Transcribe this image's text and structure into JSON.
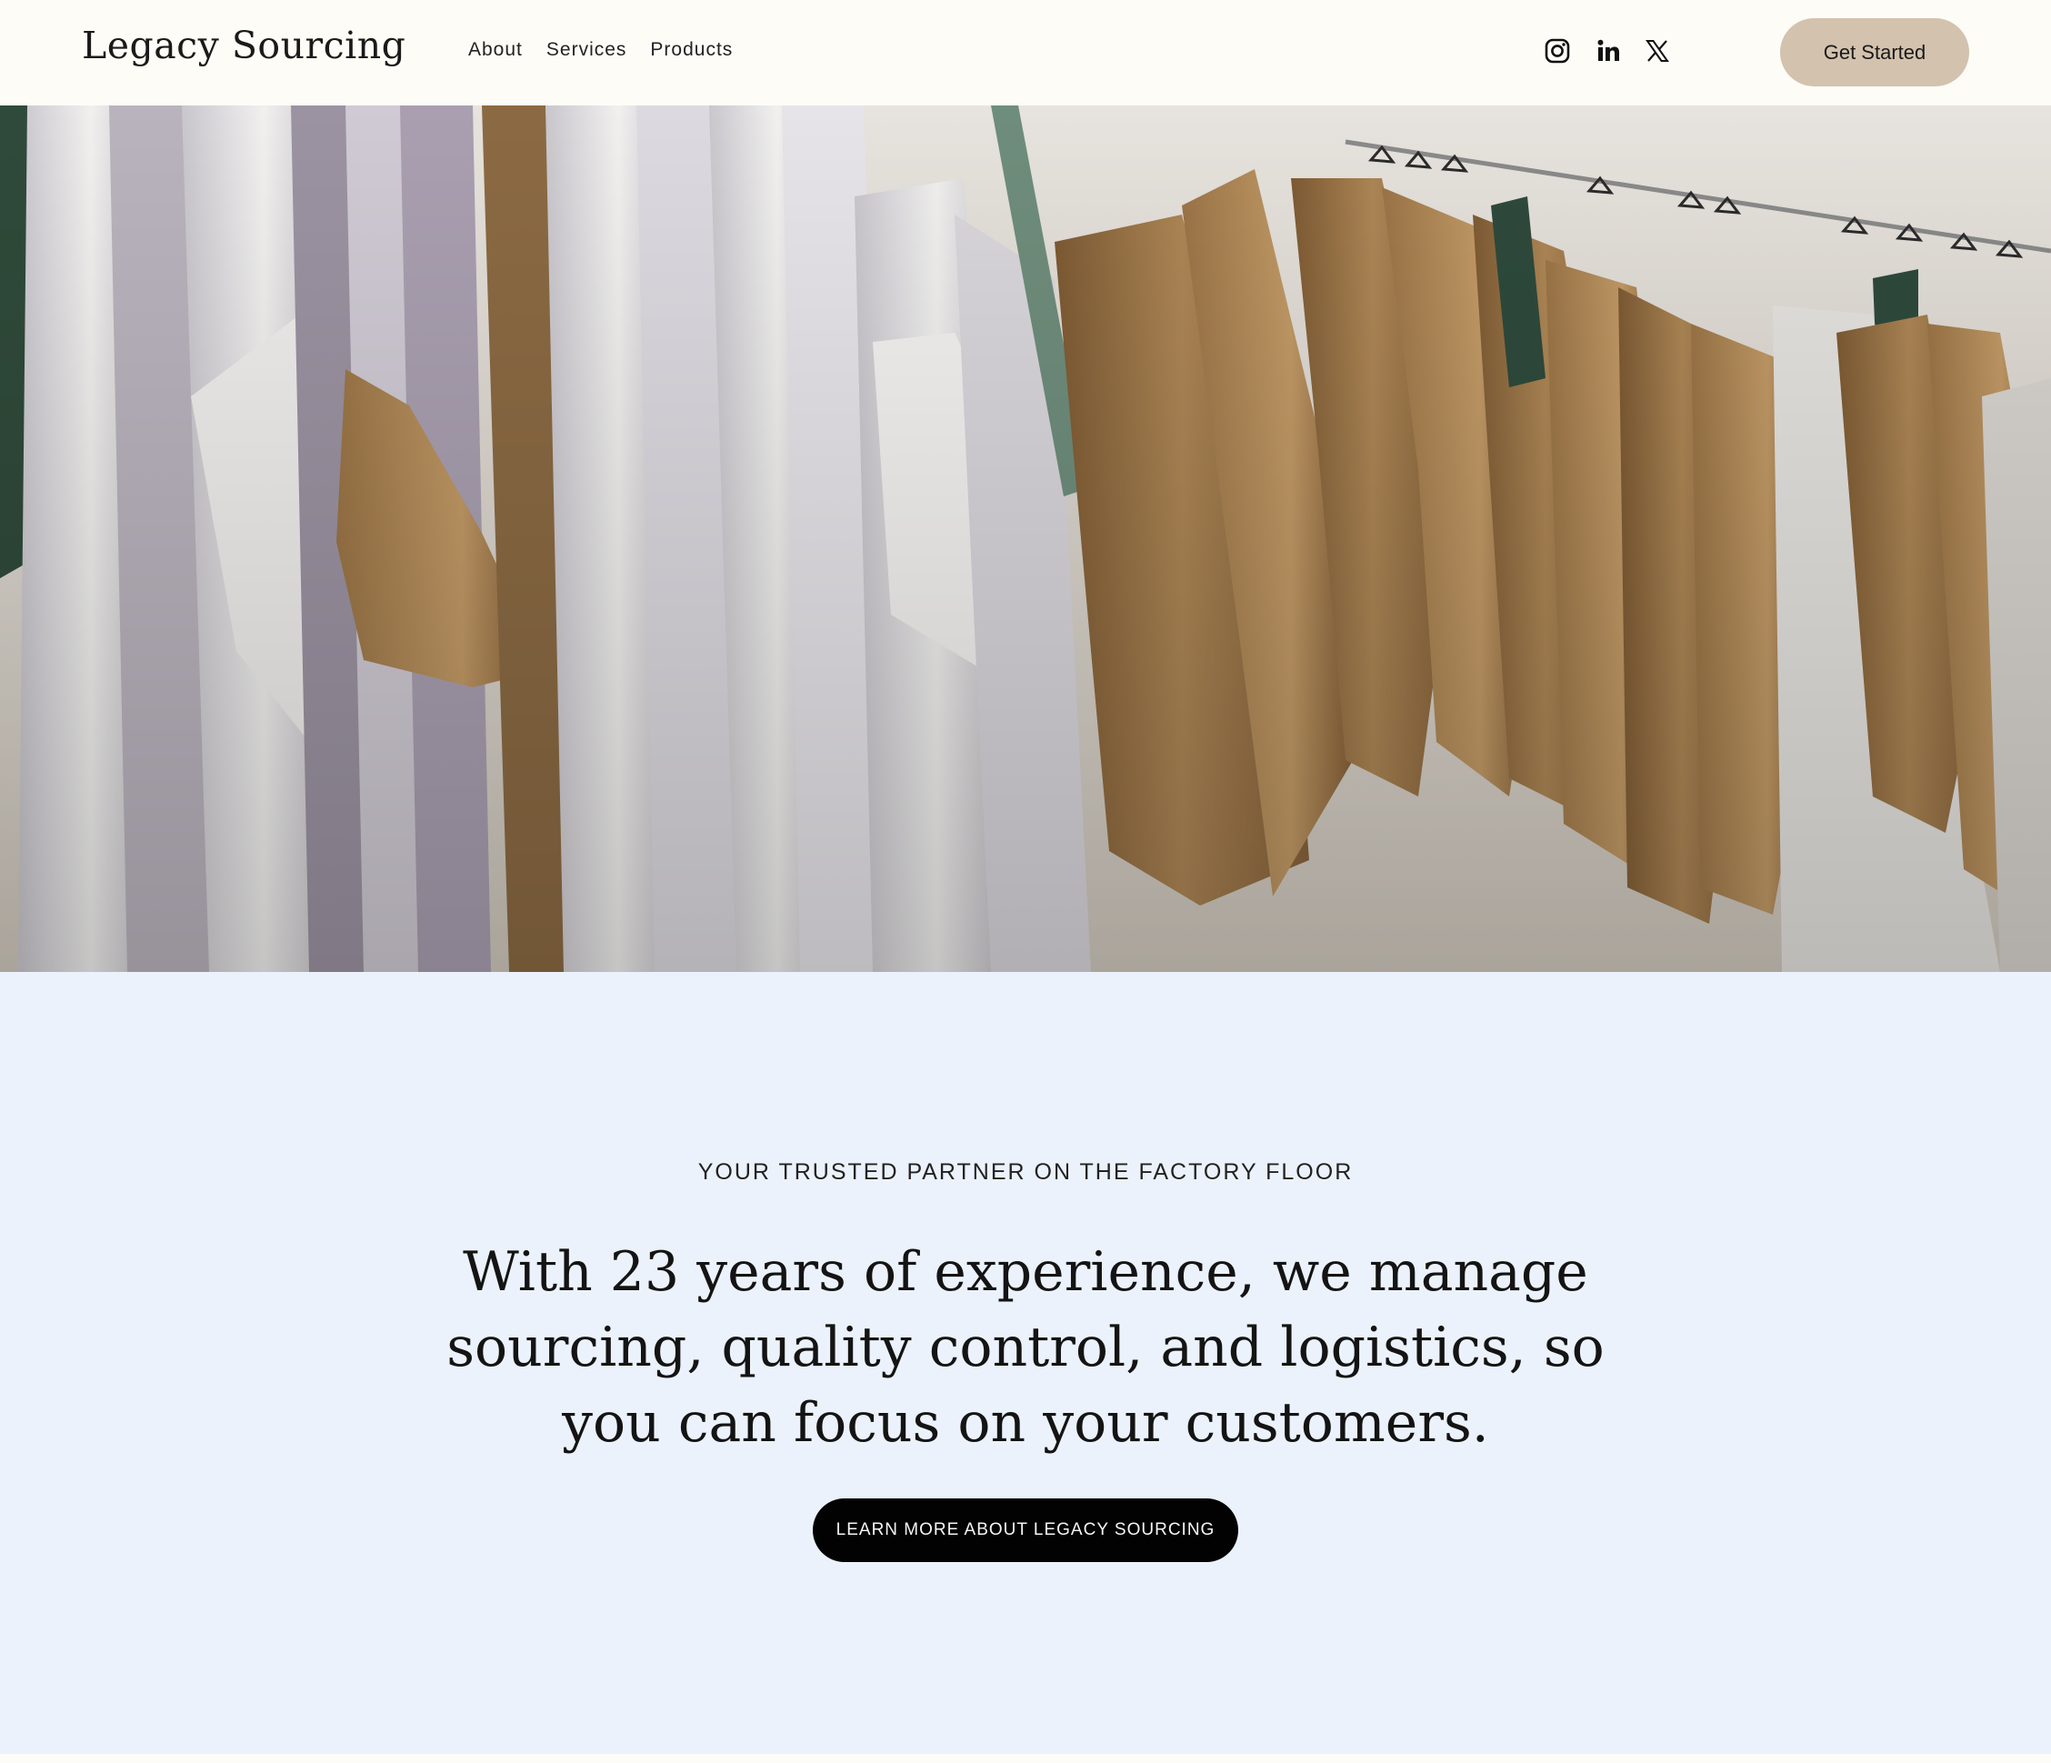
{
  "header": {
    "site_title": "Legacy Sourcing",
    "nav": [
      {
        "label": "About"
      },
      {
        "label": "Services"
      },
      {
        "label": "Products"
      }
    ],
    "social": [
      {
        "icon": "instagram-icon"
      },
      {
        "icon": "linkedin-icon"
      },
      {
        "icon": "x-icon"
      }
    ],
    "cta_label": "Get Started"
  },
  "hero": {
    "image": "hanging-paper-patterns-photo"
  },
  "intro": {
    "eyebrow": "YOUR TRUSTED PARTNER ON THE FACTORY FLOOR",
    "headline": "With 23 years of experience, we manage sourcing, quality control, and logistics, so you can focus on your customers.",
    "button_label": "LEARN MORE ABOUT LEGACY SOURCING"
  },
  "colors": {
    "header_bg": "#fdfcf7",
    "cta_bg": "#d3c2ad",
    "intro_bg": "#ecf2fb",
    "button_bg": "#020202",
    "kraft": "#a07a4a",
    "paper_white": "#ecebe8"
  }
}
